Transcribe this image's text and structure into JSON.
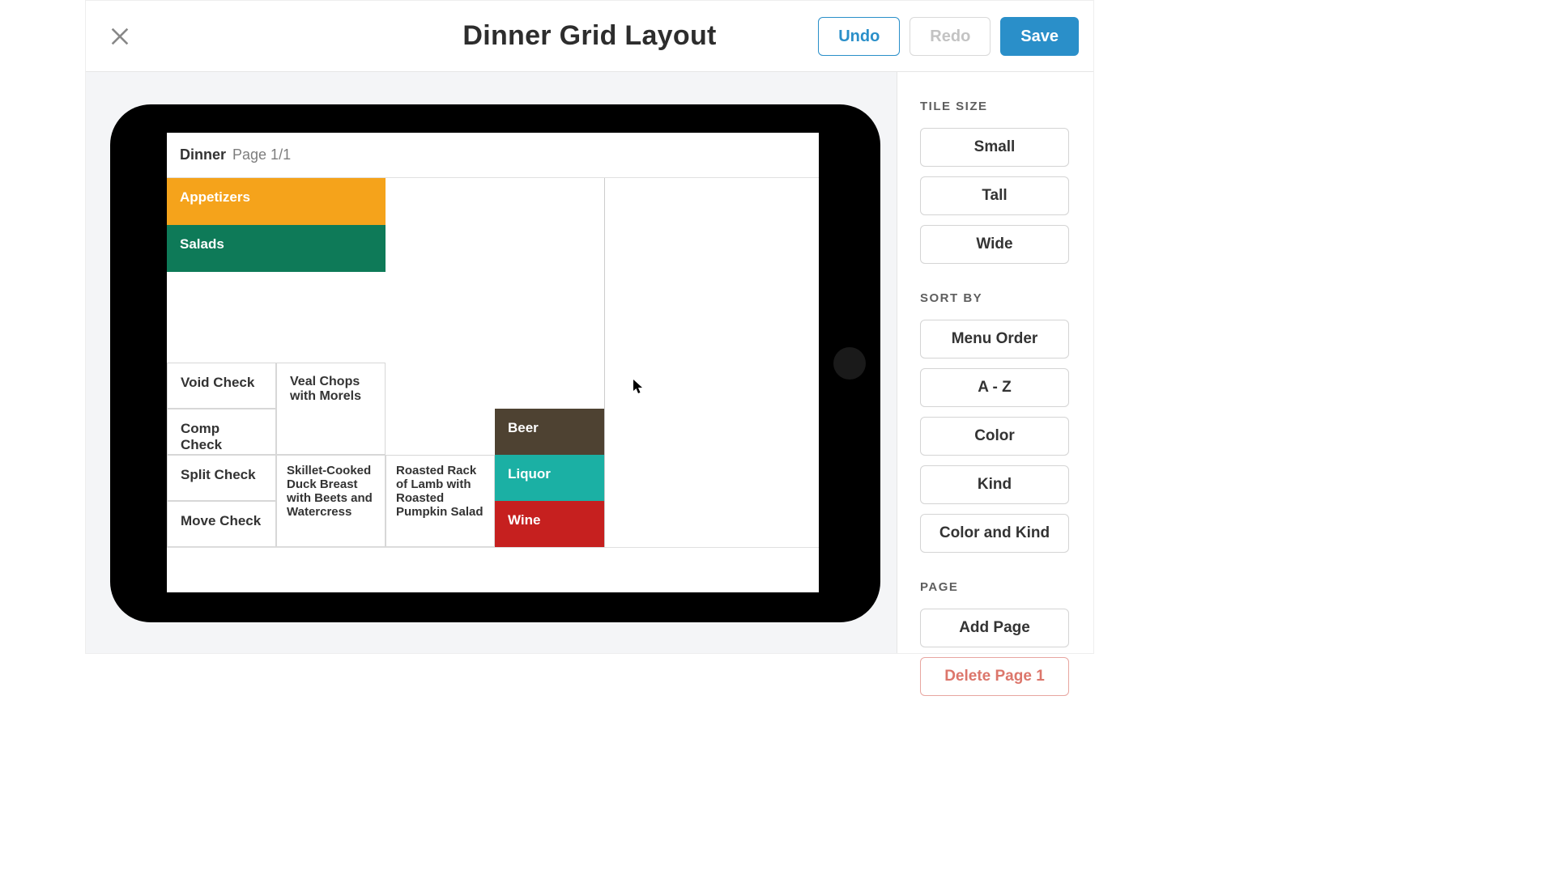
{
  "header": {
    "title": "Dinner Grid Layout",
    "undo": "Undo",
    "redo": "Redo",
    "save": "Save"
  },
  "screen": {
    "menu_name": "Dinner",
    "page_label": "Page 1/1"
  },
  "tiles": {
    "appetizers": "Appetizers",
    "salads": "Salads",
    "void_check": "Void Check",
    "comp_check": "Comp Check",
    "split_check": "Split Check",
    "move_check": "Move Check",
    "veal": "Veal Chops with Morels",
    "duck": "Skillet-Cooked Duck Breast with Beets and Watercress",
    "lamb": "Roasted Rack of Lamb with Roasted Pumpkin Salad",
    "beer": "Beer",
    "liquor": "Liquor",
    "wine": "Wine"
  },
  "sidebar": {
    "tile_size_label": "TILE SIZE",
    "small": "Small",
    "tall": "Tall",
    "wide": "Wide",
    "sort_by_label": "SORT BY",
    "menu_order": "Menu Order",
    "a_z": "A - Z",
    "color": "Color",
    "kind": "Kind",
    "color_kind": "Color and Kind",
    "page_label": "PAGE",
    "add_page": "Add Page",
    "delete_page": "Delete Page 1"
  }
}
